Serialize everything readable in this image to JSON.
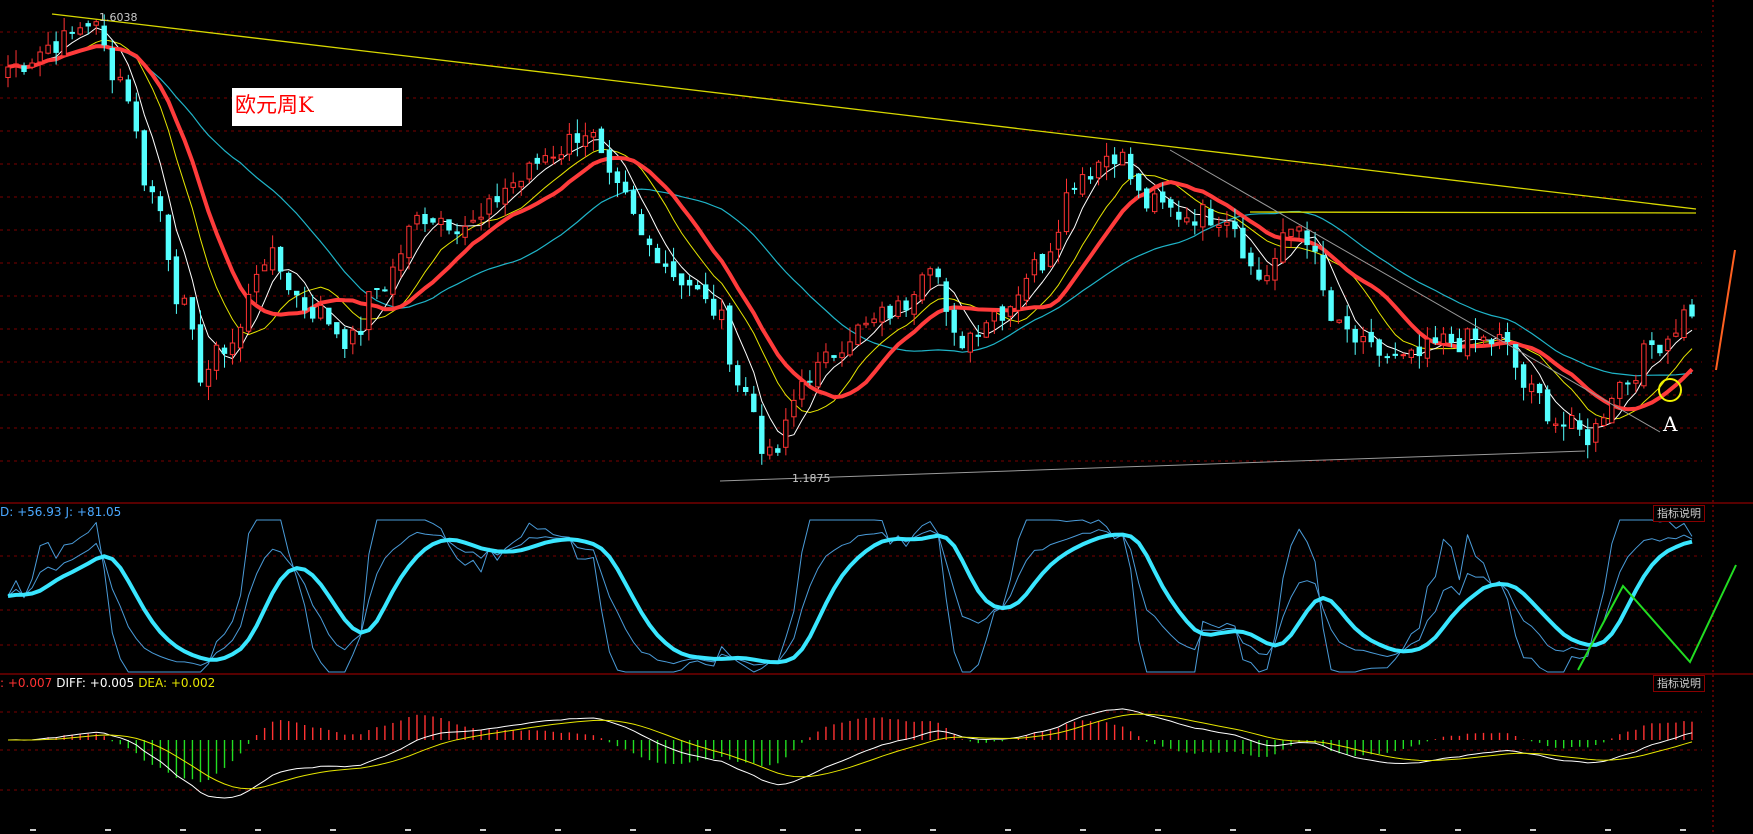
{
  "title": "欧元周K",
  "colors": {
    "background": "#000000",
    "up": "#ff3232",
    "down": "#54ffff",
    "ma_main": "#ff3b3b",
    "ma_slow": "#1fb4c8",
    "ma_white": "#ffffff",
    "ma_yellow": "#e5e500",
    "grid": "#7a0000",
    "divider": "#b00000",
    "kdj_main": "#39e6ff",
    "kdj_thin": "#4a9bd8",
    "hist_up": "#ff3232",
    "hist_down": "#22dd22",
    "diff": "#ffffff",
    "dea": "#e5e500",
    "annotation_green": "#22dd22",
    "annotation_orange": "#ff6020",
    "circle": "#f0f000"
  },
  "price_panel": {
    "high_label": "1.6038",
    "low_label": "1.1875",
    "annotation_point": "A"
  },
  "kdj_panel": {
    "readout": [
      {
        "text": "D: +56.93",
        "color": "#4aa8ff"
      },
      {
        "text": "J: +81.05",
        "color": "#4aa8ff"
      }
    ],
    "button_label": "指标说明"
  },
  "macd_panel": {
    "readout": [
      {
        "text": ": +0.007",
        "color": "#ff3232"
      },
      {
        "text": "DIFF: +0.005",
        "color": "#ffffff"
      },
      {
        "text": "DEA: +0.002",
        "color": "#e5e500"
      }
    ],
    "button_label": "指标说明"
  },
  "chart_data": {
    "type": "candlestick",
    "symbol": "欧元周K",
    "period": "weekly",
    "price_range": [
      1.17,
      1.61
    ],
    "price_anchors": [
      [
        0,
        1.56
      ],
      [
        7,
        1.585
      ],
      [
        10,
        1.6038
      ],
      [
        14,
        1.55
      ],
      [
        18,
        1.44
      ],
      [
        22,
        1.33
      ],
      [
        24,
        1.27
      ],
      [
        28,
        1.3
      ],
      [
        32,
        1.38
      ],
      [
        38,
        1.33
      ],
      [
        43,
        1.3
      ],
      [
        46,
        1.35
      ],
      [
        52,
        1.42
      ],
      [
        58,
        1.41
      ],
      [
        63,
        1.45
      ],
      [
        68,
        1.48
      ],
      [
        72,
        1.5
      ],
      [
        76,
        1.44
      ],
      [
        80,
        1.39
      ],
      [
        84,
        1.36
      ],
      [
        88,
        1.33
      ],
      [
        92,
        1.25
      ],
      [
        95,
        1.1875
      ],
      [
        100,
        1.27
      ],
      [
        106,
        1.31
      ],
      [
        111,
        1.33
      ],
      [
        115,
        1.38
      ],
      [
        118,
        1.3
      ],
      [
        124,
        1.33
      ],
      [
        128,
        1.37
      ],
      [
        134,
        1.46
      ],
      [
        138,
        1.48
      ],
      [
        142,
        1.43
      ],
      [
        147,
        1.42
      ],
      [
        152,
        1.42
      ],
      [
        156,
        1.36
      ],
      [
        161,
        1.41
      ],
      [
        166,
        1.31
      ],
      [
        170,
        1.29
      ],
      [
        174,
        1.28
      ],
      [
        180,
        1.3
      ],
      [
        186,
        1.3
      ],
      [
        190,
        1.25
      ],
      [
        194,
        1.22
      ],
      [
        197,
        1.21
      ],
      [
        201,
        1.26
      ],
      [
        206,
        1.3
      ],
      [
        210,
        1.33
      ]
    ],
    "last_d": 56.93,
    "last_j": 81.05,
    "last_macd": 0.007,
    "last_diff": 0.005,
    "last_dea": 0.002
  }
}
